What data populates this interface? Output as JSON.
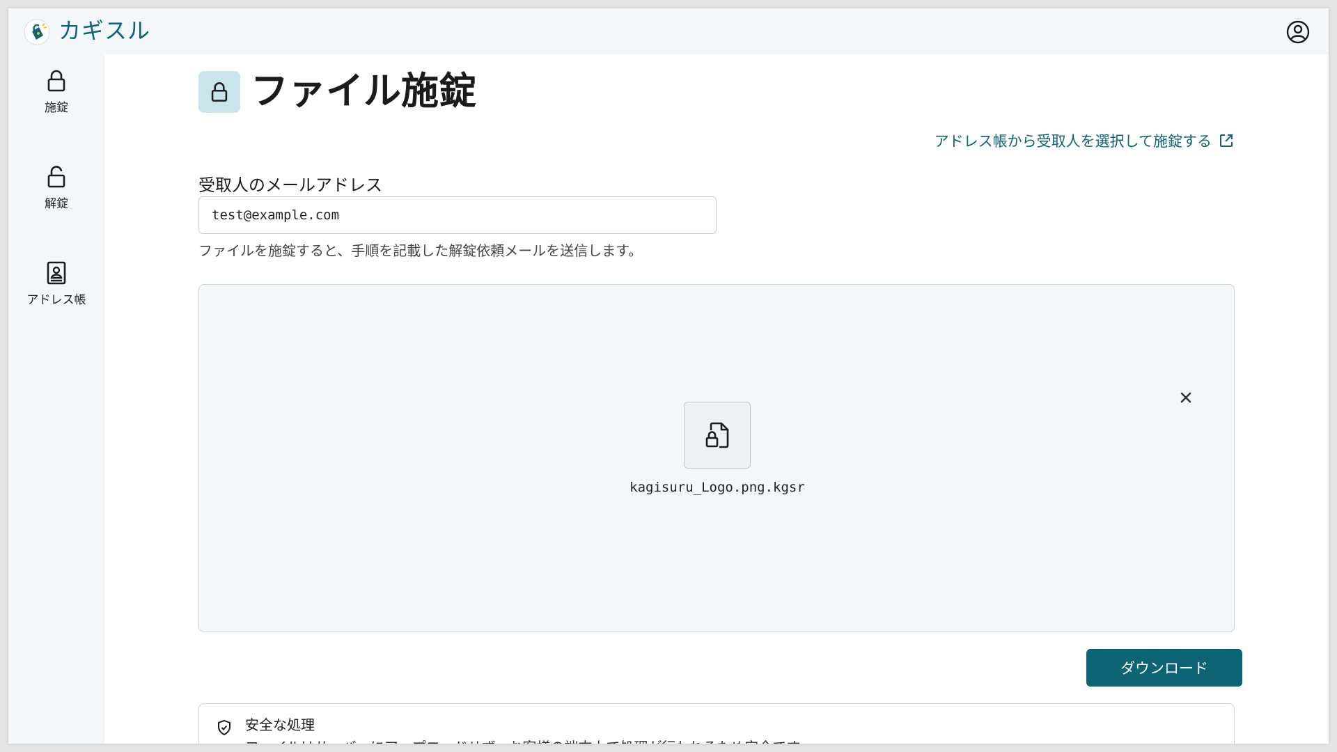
{
  "app": {
    "title": "カギスル"
  },
  "sidebar": {
    "items": [
      {
        "label": "施錠",
        "icon": "lock-icon"
      },
      {
        "label": "解錠",
        "icon": "unlock-icon"
      },
      {
        "label": "アドレス帳",
        "icon": "address-book-icon"
      }
    ]
  },
  "main": {
    "title": "ファイル施錠",
    "address_link": "アドレス帳から受取人を選択して施錠する",
    "email_label": "受取人のメールアドレス",
    "email_value": "test@example.com",
    "helper_text": "ファイルを施錠すると、手順を記載した解錠依頼メールを送信します。",
    "file": {
      "name": "kagisuru_Logo.png.kgsr",
      "icon": "locked-file-icon"
    },
    "download_label": "ダウンロード",
    "notice": {
      "title": "安全な処理",
      "body": "ファイルはサーバーにアップロードせず、お客様の端末上で処理が行われるため安全です。"
    }
  },
  "colors": {
    "accent": "#0d6475",
    "sidebar_bg": "#f3f7f9",
    "title_icon_bg": "#c9e4ea"
  }
}
